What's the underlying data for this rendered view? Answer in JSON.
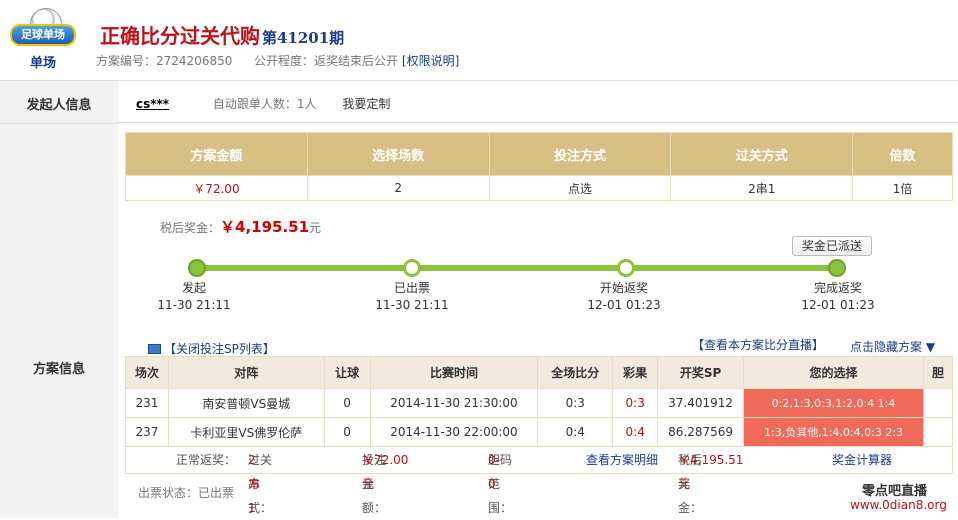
{
  "header": {
    "logo_text": "足球单场",
    "logo_sub": "单场",
    "title": "正确比分过关代购",
    "period": "第41201期",
    "plan_no_label": "方案编号：",
    "plan_no": "2724206850",
    "visibility_label": "公开程度：",
    "visibility": "返奖结束后公开",
    "permission_link": "[权限说明]"
  },
  "labels": {
    "initiator": "发起人信息",
    "plan": "方案信息"
  },
  "initiator": {
    "user": "cs***",
    "auto_follow": "自动跟单人数：1人",
    "custom": "我要定制"
  },
  "summary": {
    "headers": [
      "方案金额",
      "选择场数",
      "投注方式",
      "过关方式",
      "倍数"
    ],
    "values": [
      "￥72.00",
      "2",
      "点选",
      "2串1",
      "1倍"
    ]
  },
  "bonus": {
    "label": "税后奖金：",
    "amount": "￥4,195.51",
    "unit": "元"
  },
  "dispatched": "奖金已派送",
  "steps": [
    {
      "name": "发起",
      "time": "11-30 21:11"
    },
    {
      "name": "已出票",
      "time": "11-30 21:11"
    },
    {
      "name": "开始返奖",
      "time": "12-01 01:23"
    },
    {
      "name": "完成返奖",
      "time": "12-01 01:23"
    }
  ],
  "links": {
    "toggle_sp": "【关闭投注SP列表】",
    "live": "【查看本方案比分直播】",
    "hide": "点击隐藏方案 ▼"
  },
  "detail": {
    "headers": [
      "场次",
      "对阵",
      "让球",
      "比赛时间",
      "全场比分",
      "彩果",
      "开奖SP",
      "您的选择",
      "胆"
    ],
    "rows": [
      {
        "no": "231",
        "match": "南安普顿VS曼城",
        "handicap": "0",
        "time": "2014-11-30 21:30:00",
        "score": "0:3",
        "result": "0:3",
        "sp": "37.401912",
        "choice": "0:2,1:3,0:3,1:2,0:4 1:4",
        "banker": ""
      },
      {
        "no": "237",
        "match": "卡利亚里VS佛罗伦萨",
        "handicap": "0",
        "time": "2014-11-30 22:00:00",
        "score": "0:4",
        "result": "0:4",
        "sp": "86.287569",
        "choice": "1:3,负其他,1:4,0:4,0:3 2:3",
        "banker": ""
      }
    ]
  },
  "footer": {
    "normal": "正常返奖：",
    "pass_label": "过关方式：",
    "pass_value": "2串1",
    "bet_label": "投注金额：",
    "bet_value": "￥72.00元",
    "range_label": "胆码范围：",
    "range_value": "0-0",
    "detail_link": "查看方案明细",
    "after_tax_label": "税后奖金：",
    "after_tax_value": "￥4,195.51元",
    "calc_link": "奖金计算器"
  },
  "ticket_status": "出票状态：已出票",
  "watermark": {
    "line1": "零点吧直播",
    "line2": "www.0dian8.org"
  },
  "colors": {
    "title_red": "#c0101a",
    "table_gold": "#d8c084",
    "progress_green": "#8bc43a",
    "choice_red": "#f06a5a",
    "link_blue": "#1a3c8a"
  }
}
